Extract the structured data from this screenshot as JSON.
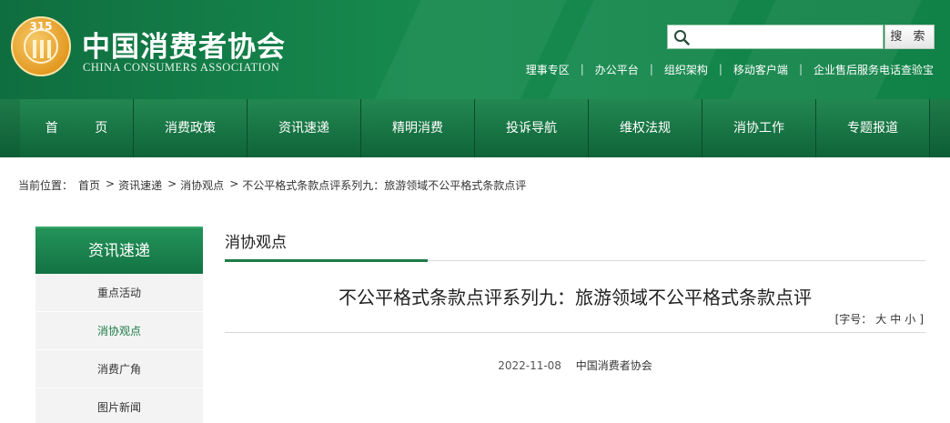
{
  "header": {
    "emblem_text": "315",
    "name_cn": "中国消费者协会",
    "name_en": "CHINA CONSUMERS ASSOCIATION",
    "search": {
      "placeholder": "",
      "button_label": "搜 索"
    },
    "top_links": [
      "理事专区",
      "办公平台",
      "组织架构",
      "移动客户端",
      "企业售后服务电话查验宝"
    ]
  },
  "nav": {
    "items": [
      "首 页",
      "消费政策",
      "资讯速递",
      "精明消费",
      "投诉导航",
      "维权法规",
      "消协工作",
      "专题报道"
    ]
  },
  "breadcrumb": {
    "label": "当前位置：",
    "items": [
      "首页",
      "资讯速递",
      "消协观点",
      "不公平格式条款点评系列九：旅游领域不公平格式条款点评"
    ]
  },
  "sidebar": {
    "title": "资讯速递",
    "items": [
      "重点活动",
      "消协观点",
      "消费广角",
      "图片新闻"
    ],
    "active_index": 1
  },
  "main": {
    "section_title": "消协观点",
    "article_title": "不公平格式条款点评系列九：旅游领域不公平格式条款点评",
    "font_size": {
      "label": "[字号：",
      "large": "大",
      "medium": "中",
      "small": "小",
      "close": "]"
    },
    "date": "2022-11-08",
    "source": "中国消费者协会"
  },
  "colors": {
    "brand_green": "#178a4f",
    "nav_dark": "#0d5d35",
    "accent": "#1e7c47"
  }
}
